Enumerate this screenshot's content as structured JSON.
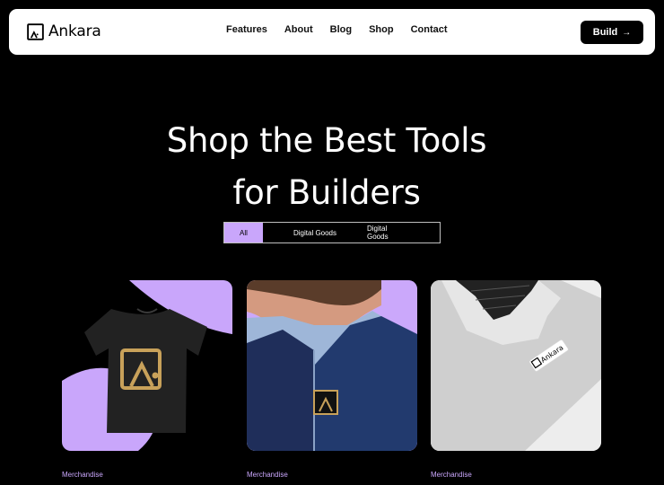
{
  "brand": {
    "name": "Ankara"
  },
  "nav": {
    "links": [
      "Features",
      "About",
      "Blog",
      "Shop",
      "Contact"
    ],
    "cta": {
      "label": "Build",
      "arrow": "→"
    }
  },
  "hero": {
    "line1": "Shop the Best Tools",
    "line2": "for Builders"
  },
  "filters": {
    "all": "All",
    "tab2": "Digital Goods",
    "tab3": "Digital Goods"
  },
  "products": [
    {
      "category": "Merchandise",
      "image": "tshirt"
    },
    {
      "category": "Merchandise",
      "image": "lapel-pin"
    },
    {
      "category": "Merchandise",
      "image": "laptop-sticker"
    }
  ],
  "colors": {
    "accent": "#c9a6fb",
    "background": "#000000"
  },
  "sticker": {
    "text": "Ankara"
  }
}
